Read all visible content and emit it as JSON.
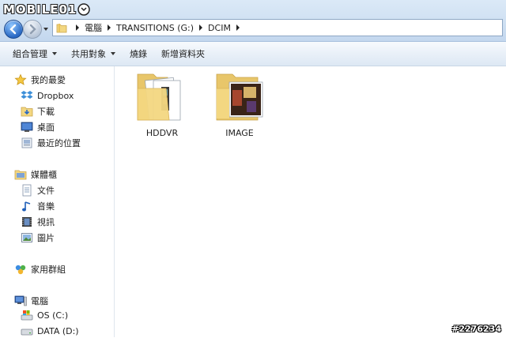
{
  "watermark": {
    "text": "MOBILE01"
  },
  "address": {
    "crumbs": [
      "電腦",
      "TRANSITIONS (G:)",
      "DCIM"
    ]
  },
  "toolbar": {
    "organize": "組合管理",
    "share": "共用對象",
    "burn": "燒錄",
    "new_folder": "新增資料夾"
  },
  "nav": {
    "favorites": "我的最愛",
    "dropbox": "Dropbox",
    "downloads": "下載",
    "desktop": "桌面",
    "recent": "最近的位置",
    "libraries": "媒體櫃",
    "documents": "文件",
    "music": "音樂",
    "videos": "視訊",
    "pictures": "圖片",
    "homegroup": "家用群組",
    "computer": "電腦",
    "drive_c": "OS (C:)",
    "drive_d": "DATA (D:)"
  },
  "folders": [
    {
      "name": "HDDVR",
      "icon": "folder-with-video-icon"
    },
    {
      "name": "IMAGE",
      "icon": "folder-with-photo-icon"
    }
  ],
  "photo_id": "#2276234",
  "colors": {
    "folder": "#f3d781",
    "folder_dark": "#d9b45a",
    "accent": "#2a69c4"
  }
}
